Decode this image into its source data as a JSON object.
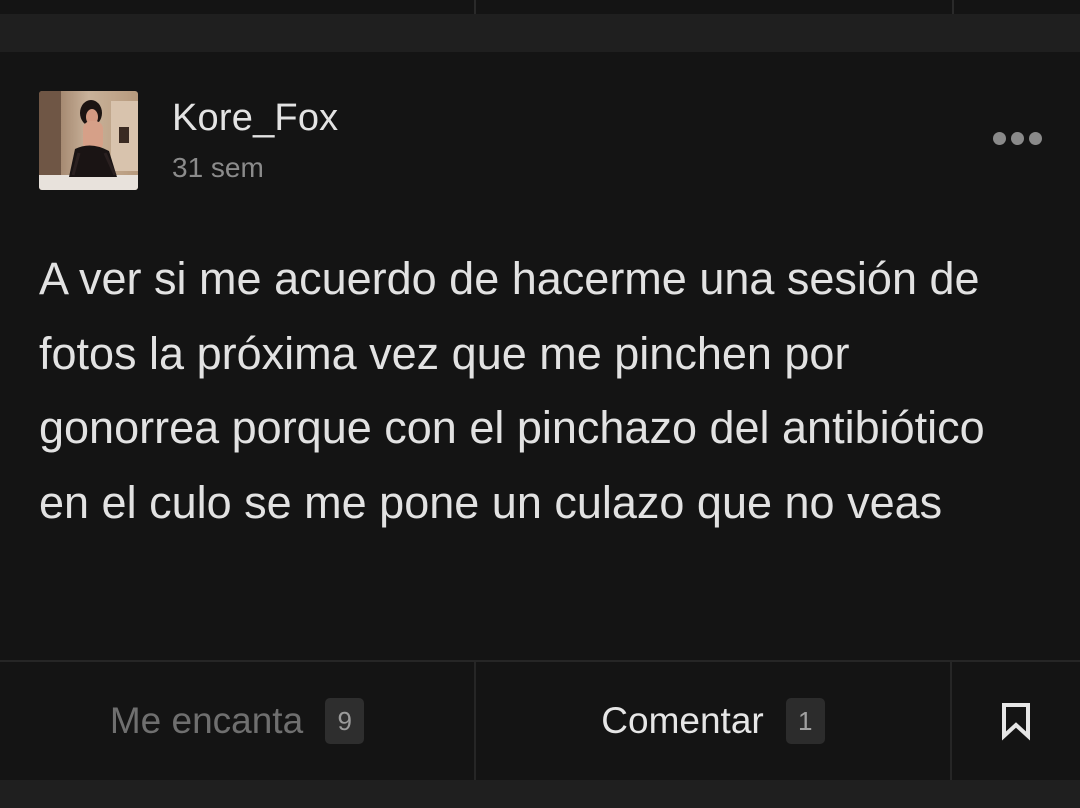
{
  "post": {
    "author": {
      "name": "Kore_Fox",
      "avatar_icon": "user-avatar-photo"
    },
    "time": "31 sem",
    "more_icon": "more-dots-icon",
    "text": "A ver si me acuerdo de hacerme una sesión de fotos la próxima vez que me pinchen por gonorrea porque con el pinchazo del antibiótico en el culo se me pone un culazo que no veas"
  },
  "actions": {
    "like": {
      "label": "Me encanta",
      "count": "9"
    },
    "comment": {
      "label": "Comentar",
      "count": "1"
    },
    "save": {
      "icon": "bookmark-icon"
    }
  },
  "colors": {
    "background": "#141414",
    "page_gap": "#1f1f1f",
    "text_primary": "#e2e2e2",
    "text_muted": "#8b8b8b",
    "like_inactive": "#6f6f6f",
    "badge_bg": "#2c2c2c"
  }
}
